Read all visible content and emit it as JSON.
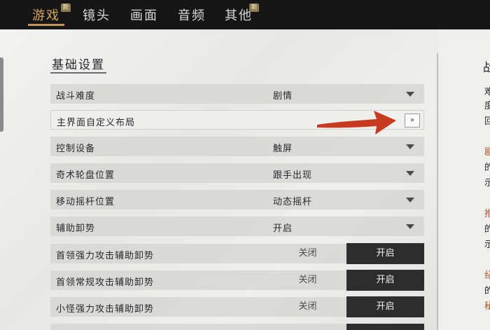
{
  "tabs": [
    {
      "label": "游戏",
      "active": true,
      "badge": "新"
    },
    {
      "label": "镜头"
    },
    {
      "label": "画面"
    },
    {
      "label": "音频"
    },
    {
      "label": "其他",
      "badge": "新"
    }
  ],
  "section": {
    "title": "基础设置"
  },
  "settings": [
    {
      "label": "战斗难度",
      "value": "剧情",
      "type": "dropdown"
    },
    {
      "label": "主界面自定义布局",
      "value": "»",
      "type": "link"
    },
    {
      "label": "控制设备",
      "value": "触屏",
      "type": "dropdown"
    },
    {
      "label": "奇术轮盘位置",
      "value": "跟手出现",
      "type": "dropdown"
    },
    {
      "label": "移动摇杆位置",
      "value": "动态摇杆",
      "type": "dropdown"
    },
    {
      "label": "辅助卸势",
      "value": "开启",
      "type": "dropdown"
    },
    {
      "label": "首领强力攻击辅助卸势",
      "off": "关闭",
      "on": "开启",
      "type": "toggle"
    },
    {
      "label": "首领常规攻击辅助卸势",
      "off": "关闭",
      "on": "开启",
      "type": "toggle"
    },
    {
      "label": "小怪强力攻击辅助卸势",
      "off": "关闭",
      "on": "开启",
      "type": "toggle"
    }
  ],
  "right_panel": {
    "title": "战",
    "lines": [
      "难",
      "度",
      "回",
      "剧",
      "的",
      "示",
      "推",
      "的",
      "示",
      "纪",
      "的",
      "秘"
    ]
  },
  "colors": {
    "accent": "#c49450",
    "arrow": "#c8391f",
    "toggle_on_bg": "#2d2d2d"
  },
  "icons": {
    "dropdown": "chevron-down-icon",
    "arrow": "double-chevron-right-icon"
  }
}
